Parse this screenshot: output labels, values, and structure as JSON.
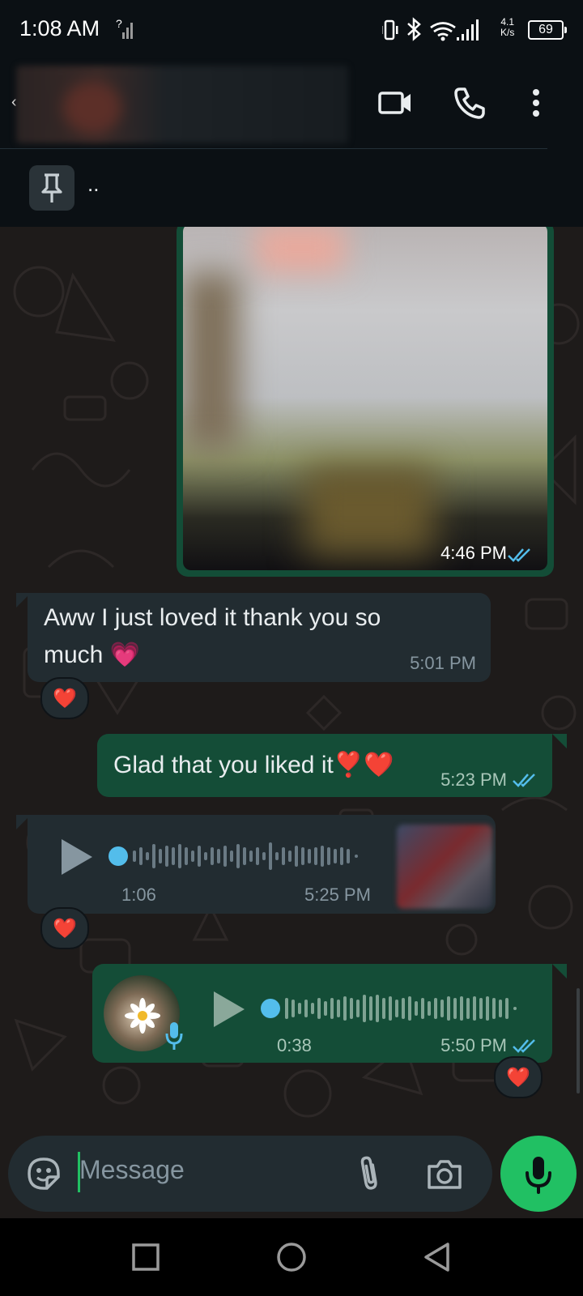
{
  "status_bar": {
    "time": "1:08 AM",
    "speed_value": "4.1",
    "speed_unit": "K/s",
    "battery": "69"
  },
  "pinned": {
    "text": ".."
  },
  "messages": {
    "image_time": "4:46 PM",
    "in1_line1": "Aww I just loved it thank you so",
    "in1_line2": "much 💗",
    "in1_time": "5:01 PM",
    "out1_text": "Glad that you liked it❣️❤️",
    "out1_time": "5:23 PM",
    "voice_in_duration": "1:06",
    "voice_in_time": "5:25 PM",
    "voice_out_duration": "0:38",
    "voice_out_time": "5:50 PM",
    "reaction": "❤️"
  },
  "composer": {
    "placeholder": "Message"
  },
  "colors": {
    "accent": "#21c063",
    "outgoing_bubble": "#144d37",
    "incoming_bubble": "#222c31",
    "read_tick": "#53bdeb"
  },
  "icons": [
    "video-call-icon",
    "voice-call-icon",
    "more-options-icon",
    "pin-icon",
    "sticker-icon",
    "attach-icon",
    "camera-icon",
    "mic-icon",
    "play-icon",
    "nav-recent-icon",
    "nav-home-icon",
    "nav-back-icon"
  ]
}
